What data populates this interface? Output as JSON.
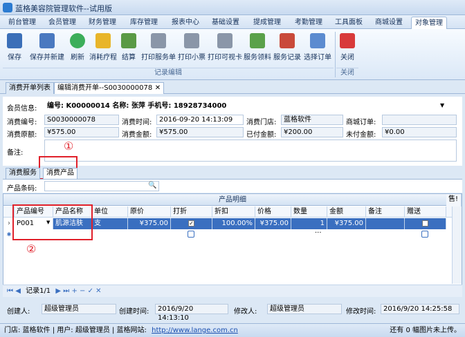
{
  "app": {
    "title": "蓝格美容院管理软件--试用版"
  },
  "menu": [
    "前台管理",
    "会员管理",
    "财务管理",
    "库存管理",
    "报表中心",
    "基础设置",
    "提成管理",
    "考勤管理",
    "工具面板",
    "商城设置",
    "对象管理"
  ],
  "ribbon": {
    "buttons": [
      "保存",
      "保存并新建",
      "刷新",
      "消耗疗程",
      "结算",
      "打印服务单",
      "打印小票",
      "打印可视卡",
      "服务领料",
      "服务记录",
      "选择订单"
    ],
    "group_label": "记录编辑",
    "close_label": "关闭",
    "close_group": "关闭"
  },
  "doctabs": [
    "消费开单列表",
    "编辑消费开单--S0030000078"
  ],
  "form": {
    "member_label": "会员信息:",
    "member_value": "编号: K00000014   名称: 张萍   手机号: 18928734000",
    "id_label": "消费编号:",
    "id_value": "S0030000078",
    "time_label": "消费时间:",
    "time_value": "2016-09-20 14:13:09",
    "store_label": "消费门店:",
    "store_value": "蓝格软件",
    "mall_label": "商城订单:",
    "mall_value": "",
    "orig_label": "消费原额:",
    "orig_value": "¥575.00",
    "amount_label": "消费金额:",
    "amount_value": "¥575.00",
    "paid_label": "已付金额:",
    "paid_value": "¥200.00",
    "unpaid_label": "未付金额:",
    "unpaid_value": "¥0.00",
    "remark_label": "备注:"
  },
  "subtabs": [
    "消费服务",
    "消费产品"
  ],
  "codebar": {
    "label": "产品条码:"
  },
  "grid": {
    "title": "产品明细",
    "extra_header": "售!",
    "headers": [
      "产品编号",
      "产品名称",
      "单位",
      "原价",
      "打折",
      "折扣",
      "价格",
      "数量",
      "金额",
      "备注",
      "赠送"
    ],
    "row": {
      "code": "P001",
      "name": "肌源洁肤乳",
      "unit": "支",
      "price": "¥375.00",
      "discount": "100.00%",
      "real": "¥375.00",
      "qty": "1",
      "amount": "¥375.00",
      "remark": ""
    },
    "summary_dots": "···"
  },
  "nav": {
    "record": "记录1/1"
  },
  "footer": {
    "creator_label": "创建人:",
    "creator": "超级管理员",
    "ctime_label": "创建时间:",
    "ctime": "2016/9/20 14:13:10",
    "modifier_label": "修改人:",
    "modifier": "超级管理员",
    "mtime_label": "修改时间:",
    "mtime": "2016/9/20 14:25:58"
  },
  "status": {
    "text": "门店: 蓝格软件  | 用户: 超级管理员  | 蓝格网站:",
    "link": "http://www.lange.com.cn",
    "right": "还有 0 幅图片未上传。"
  },
  "annotations": [
    "①",
    "②"
  ]
}
